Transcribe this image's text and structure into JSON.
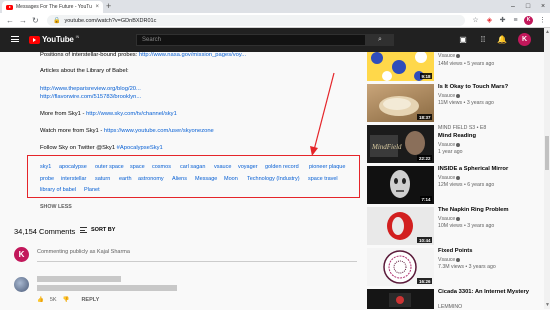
{
  "browser": {
    "tab_title": "Messages For The Future - YouTube",
    "close": "×",
    "newtab": "+",
    "url": "youtube.com/watch?v=GDnBXDR01c",
    "min": "–",
    "max": "□",
    "close_win": "×",
    "profile_initial": "K"
  },
  "header": {
    "logo_text": "YouTube",
    "logo_cc": "IN",
    "search_placeholder": "Search",
    "avatar": "K"
  },
  "description": {
    "lines": [
      {
        "pre": "Positions of interstellar-bound probes: ",
        "link": "http://www.nasa.gov/mission_pages/voy..."
      },
      {
        "pre": "Articles about the Library of Babel:",
        "link": ""
      },
      {
        "pre": "",
        "link": "http://www.theparisreview.org/blog/20..."
      },
      {
        "pre": "",
        "link": "http://flavorwire.com/515783/brooklyn..."
      },
      {
        "pre": "More from Sky1 - ",
        "link": "http://www.sky.com/tv/channel/sky1"
      },
      {
        "pre": "Watch more from Sky1 - ",
        "link": "https://www.youtube.com/user/skyonezone"
      },
      {
        "pre": "Follow Sky on Twitter @Sky1 ",
        "link": "#ApocalypseSky1"
      }
    ],
    "tags_row1": [
      "sky1",
      "apocalypse",
      "outer space",
      "space",
      "cosmos",
      "carl sagan",
      "vsauce",
      "voyager",
      "golden record",
      "pioneer plaque"
    ],
    "tags_row2": [
      "probe",
      "interstellar",
      "saturn",
      "earth",
      "astronomy",
      "Aliens",
      "Message",
      "Moon",
      "Technology (Industry)",
      "space travel"
    ],
    "tags_row3": [
      "library of babel",
      "Planet"
    ],
    "show_less": "SHOW LESS"
  },
  "comments": {
    "count": "34,154 Comments",
    "sort": "SORT BY",
    "avatar": "K",
    "public_as": "Commenting publicly as ",
    "user": "Kajal Sharma",
    "likes": "5K",
    "reply": "REPLY"
  },
  "sidebar": [
    {
      "title": "",
      "channel": "Vsauce",
      "meta": "14M views • 5 years ago",
      "duration": "9:18"
    },
    {
      "title": "Is It Okay to Touch Mars?",
      "channel": "Vsauce",
      "meta": "11M views • 3 years ago",
      "duration": "18:37"
    },
    {
      "title": "Mind Reading",
      "pre": "MIND FIELD S3 • E8",
      "channel": "Vsauce",
      "meta": "1 year ago",
      "duration": "22:22"
    },
    {
      "title": "INSIDE a Spherical Mirror",
      "channel": "Vsauce",
      "meta": "12M views • 6 years ago",
      "duration": "7:14"
    },
    {
      "title": "The Napkin Ring Problem",
      "channel": "Vsauce",
      "meta": "10M views • 3 years ago",
      "duration": "10:44"
    },
    {
      "title": "Fixed Points",
      "channel": "Vsauce",
      "meta": "7.3M views • 3 years ago",
      "duration": "16:26"
    },
    {
      "title": "Cicada 3301: An Internet Mystery",
      "channel": "LEMMINO",
      "meta": "",
      "duration": ""
    }
  ]
}
